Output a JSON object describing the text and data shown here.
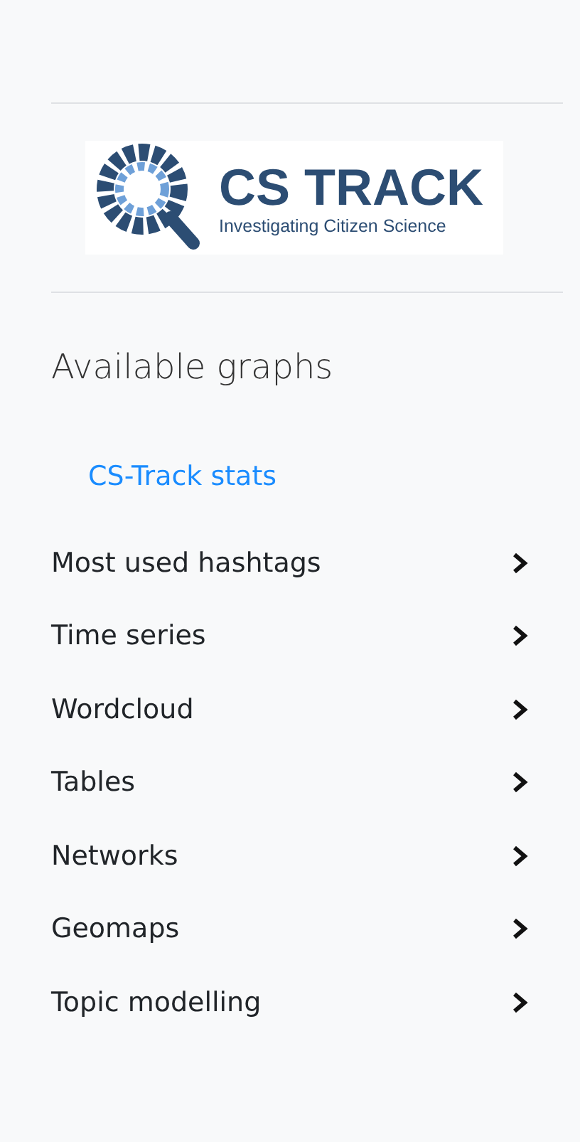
{
  "logo": {
    "title": "CS TRACK",
    "subtitle": "Investigating Citizen Science"
  },
  "heading": "Available graphs",
  "items": [
    {
      "kind": "link",
      "label": "CS-Track stats"
    },
    {
      "kind": "group",
      "label": "Most used hashtags",
      "expanded": false
    },
    {
      "kind": "group",
      "label": "Time series",
      "expanded": false
    },
    {
      "kind": "group",
      "label": "Wordcloud",
      "expanded": false
    },
    {
      "kind": "group",
      "label": "Tables",
      "expanded": false
    },
    {
      "kind": "group",
      "label": "Networks",
      "expanded": false
    },
    {
      "kind": "group",
      "label": "Geomaps",
      "expanded": false
    },
    {
      "kind": "group",
      "label": "Topic modelling",
      "expanded": false
    }
  ]
}
